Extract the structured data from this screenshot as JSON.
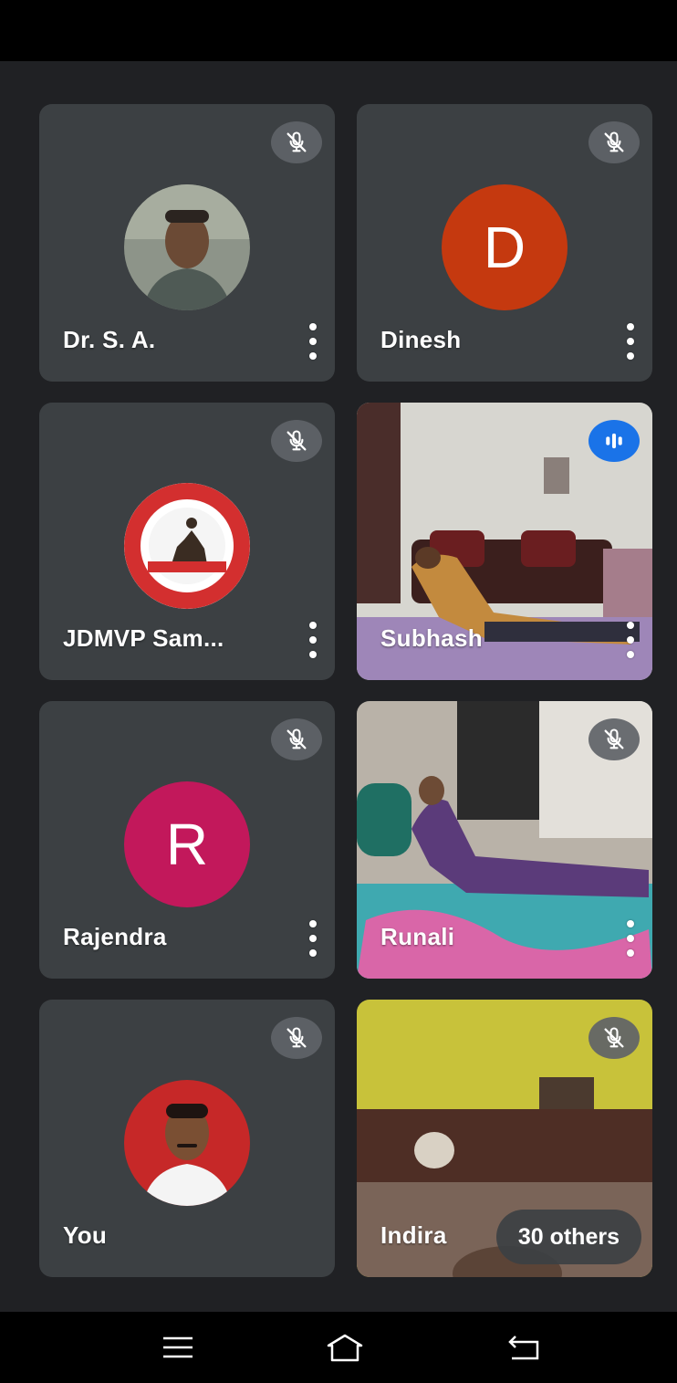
{
  "colors": {
    "background": "#202124",
    "tile": "#3c4043",
    "mute_badge": "#5f6368",
    "speaking_badge": "#1a73e8",
    "avatar_dinesh": "#c5390f",
    "avatar_rajendra": "#c2185b"
  },
  "participants": [
    {
      "name": "Dr. S. A.",
      "tile_type": "photo-avatar",
      "icon": "mic-off-icon",
      "has_menu": true
    },
    {
      "name": "Dinesh",
      "tile_type": "letter-avatar",
      "letter": "D",
      "icon": "mic-off-icon",
      "has_menu": true
    },
    {
      "name": "JDMVP Sam...",
      "tile_type": "logo-avatar",
      "icon": "mic-off-icon",
      "has_menu": true
    },
    {
      "name": "Subhash",
      "tile_type": "video",
      "icon": "speaking-icon",
      "has_menu": true
    },
    {
      "name": "Rajendra",
      "tile_type": "letter-avatar",
      "letter": "R",
      "icon": "mic-off-icon",
      "has_menu": true
    },
    {
      "name": "Runali",
      "tile_type": "video",
      "icon": "mic-off-icon",
      "has_menu": true
    },
    {
      "name": "You",
      "tile_type": "photo-avatar",
      "icon": "mic-off-icon",
      "has_menu": false
    },
    {
      "name": "Indira",
      "tile_type": "video",
      "icon": "mic-off-icon",
      "has_menu": false
    }
  ],
  "others_label": "30 others",
  "nav": {
    "recents_icon": "menu-icon",
    "home_icon": "home-icon",
    "back_icon": "back-icon"
  }
}
